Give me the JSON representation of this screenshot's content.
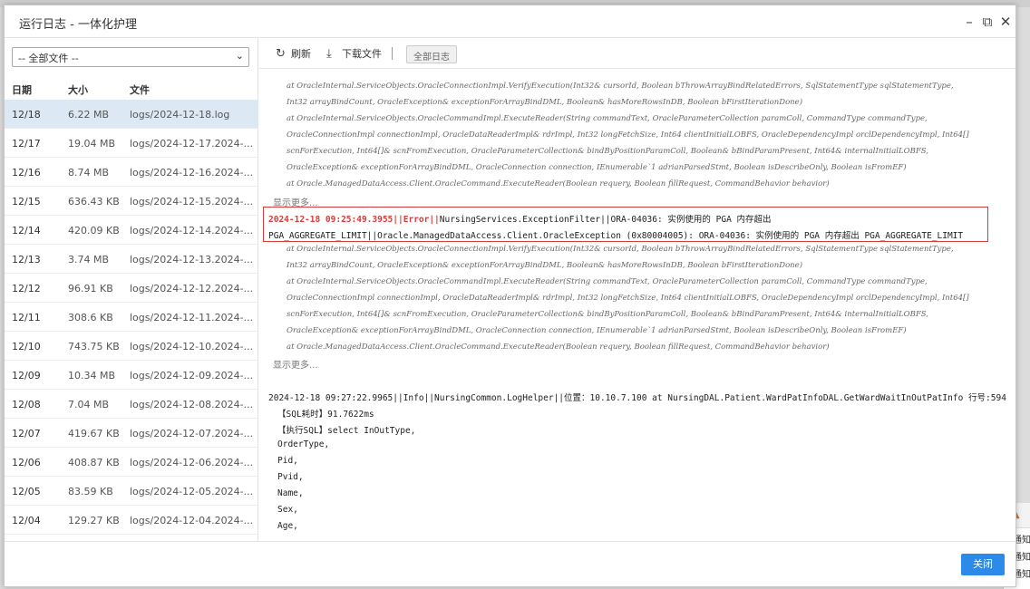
{
  "dialog": {
    "title": "运行日志 - 一体化护理",
    "minimize": "–",
    "maximize": "⧉",
    "close": "✕"
  },
  "file_filter": {
    "selected": "-- 全部文件 --"
  },
  "list": {
    "headers": {
      "date": "日期",
      "size": "大小",
      "file": "文件"
    },
    "rows": [
      {
        "date": "12/18",
        "size": "6.22 MB",
        "file": "logs/2024-12-18.log"
      },
      {
        "date": "12/17",
        "size": "19.04 MB",
        "file": "logs/2024-12-17.2024-..."
      },
      {
        "date": "12/16",
        "size": "8.74 MB",
        "file": "logs/2024-12-16.2024-..."
      },
      {
        "date": "12/15",
        "size": "636.43 KB",
        "file": "logs/2024-12-15.2024-..."
      },
      {
        "date": "12/14",
        "size": "420.09 KB",
        "file": "logs/2024-12-14.2024-..."
      },
      {
        "date": "12/13",
        "size": "3.74 MB",
        "file": "logs/2024-12-13.2024-..."
      },
      {
        "date": "12/12",
        "size": "96.91 KB",
        "file": "logs/2024-12-12.2024-..."
      },
      {
        "date": "12/11",
        "size": "308.6 KB",
        "file": "logs/2024-12-11.2024-..."
      },
      {
        "date": "12/10",
        "size": "743.75 KB",
        "file": "logs/2024-12-10.2024-..."
      },
      {
        "date": "12/09",
        "size": "10.34 MB",
        "file": "logs/2024-12-09.2024-..."
      },
      {
        "date": "12/08",
        "size": "7.04 MB",
        "file": "logs/2024-12-08.2024-..."
      },
      {
        "date": "12/07",
        "size": "419.67 KB",
        "file": "logs/2024-12-07.2024-..."
      },
      {
        "date": "12/06",
        "size": "408.87 KB",
        "file": "logs/2024-12-06.2024-..."
      },
      {
        "date": "12/05",
        "size": "83.59 KB",
        "file": "logs/2024-12-05.2024-..."
      },
      {
        "date": "12/04",
        "size": "129.27 KB",
        "file": "logs/2024-12-04.2024-..."
      }
    ]
  },
  "toolbar": {
    "refresh": "刷新",
    "download": "下载文件",
    "separator": "|",
    "all_logs": "全部日志"
  },
  "log": {
    "stack1": [
      "at OracleInternal.ServiceObjects.OracleConnectionImpl.VerifyExecution(Int32& cursorId, Boolean bThrowArrayBindRelatedErrors, SqlStatementType sqlStatementType,",
      "Int32 arrayBindCount, OracleException& exceptionForArrayBindDML, Boolean& hasMoreRowsInDB, Boolean bFirstIterationDone)",
      "at OracleInternal.ServiceObjects.OracleCommandImpl.ExecuteReader(String commandText, OracleParameterCollection paramColl, CommandType commandType,",
      "OracleConnectionImpl connectionImpl, OracleDataReaderImpl& rdrImpl, Int32 longFetchSize, Int64 clientInitialLOBFS, OracleDependencyImpl orclDependencyImpl, Int64[]",
      "scnForExecution, Int64[]& scnFromExecution, OracleParameterCollection& bindByPositionParamColl, Boolean& bBindParamPresent, Int64& internalInitialLOBFS,",
      "OracleException& exceptionForArrayBindDML, OracleConnection connection, IEnumerable`1 adrianParsedStmt, Boolean isDescribeOnly, Boolean isFromEF)",
      "at Oracle.ManagedDataAccess.Client.OracleCommand.ExecuteReader(Boolean requery, Boolean fillRequest, CommandBehavior behavior)"
    ],
    "show_more": "显示更多...",
    "error": {
      "timestamp": "2024-12-18 09:25:49.3955",
      "level": "||Error||",
      "line1_rest": "NursingServices.ExceptionFilter||ORA-04036: 实例使用的 PGA 内存超出",
      "line2": "PGA_AGGREGATE_LIMIT||Oracle.ManagedDataAccess.Client.OracleException (0x80004005): ORA-04036: 实例使用的 PGA 内存超出 PGA_AGGREGATE_LIMIT"
    },
    "stack2": [
      "at OracleInternal.ServiceObjects.OracleConnectionImpl.VerifyExecution(Int32& cursorId, Boolean bThrowArrayBindRelatedErrors, SqlStatementType sqlStatementType,",
      "Int32 arrayBindCount, OracleException& exceptionForArrayBindDML, Boolean& hasMoreRowsInDB, Boolean bFirstIterationDone)",
      "at OracleInternal.ServiceObjects.OracleCommandImpl.ExecuteReader(String commandText, OracleParameterCollection paramColl, CommandType commandType,",
      "OracleConnectionImpl connectionImpl, OracleDataReaderImpl& rdrImpl, Int32 longFetchSize, Int64 clientInitialLOBFS, OracleDependencyImpl orclDependencyImpl, Int64[]",
      "scnForExecution, Int64[]& scnFromExecution, OracleParameterCollection& bindByPositionParamColl, Boolean& bBindParamPresent, Int64& internalInitialLOBFS,",
      "OracleException& exceptionForArrayBindDML, OracleConnection connection, IEnumerable`1 adrianParsedStmt, Boolean isDescribeOnly, Boolean isFromEF)",
      "at Oracle.ManagedDataAccess.Client.OracleCommand.ExecuteReader(Boolean requery, Boolean fillRequest, CommandBehavior behavior)"
    ],
    "show_more2": "显示更多...",
    "info_line": "2024-12-18 09:27:22.9965||Info||NursingCommon.LogHelper||位置：10.10.7.100 at NursingDAL.Patient.WardPatInfoDAL.GetWardWaitInOutPatInfo 行号:594",
    "sql_time": "【SQL耗时】91.7622ms",
    "sql_exec": "【执行SQL】select InOutType,",
    "sql_fields": [
      "OrderType,",
      "Pid,",
      "Pvid,",
      "Name,",
      "Sex,",
      "Age,"
    ]
  },
  "footer": {
    "close": "关闭"
  },
  "background_notice": {
    "items": [
      "通知",
      "通知",
      "通知"
    ]
  }
}
